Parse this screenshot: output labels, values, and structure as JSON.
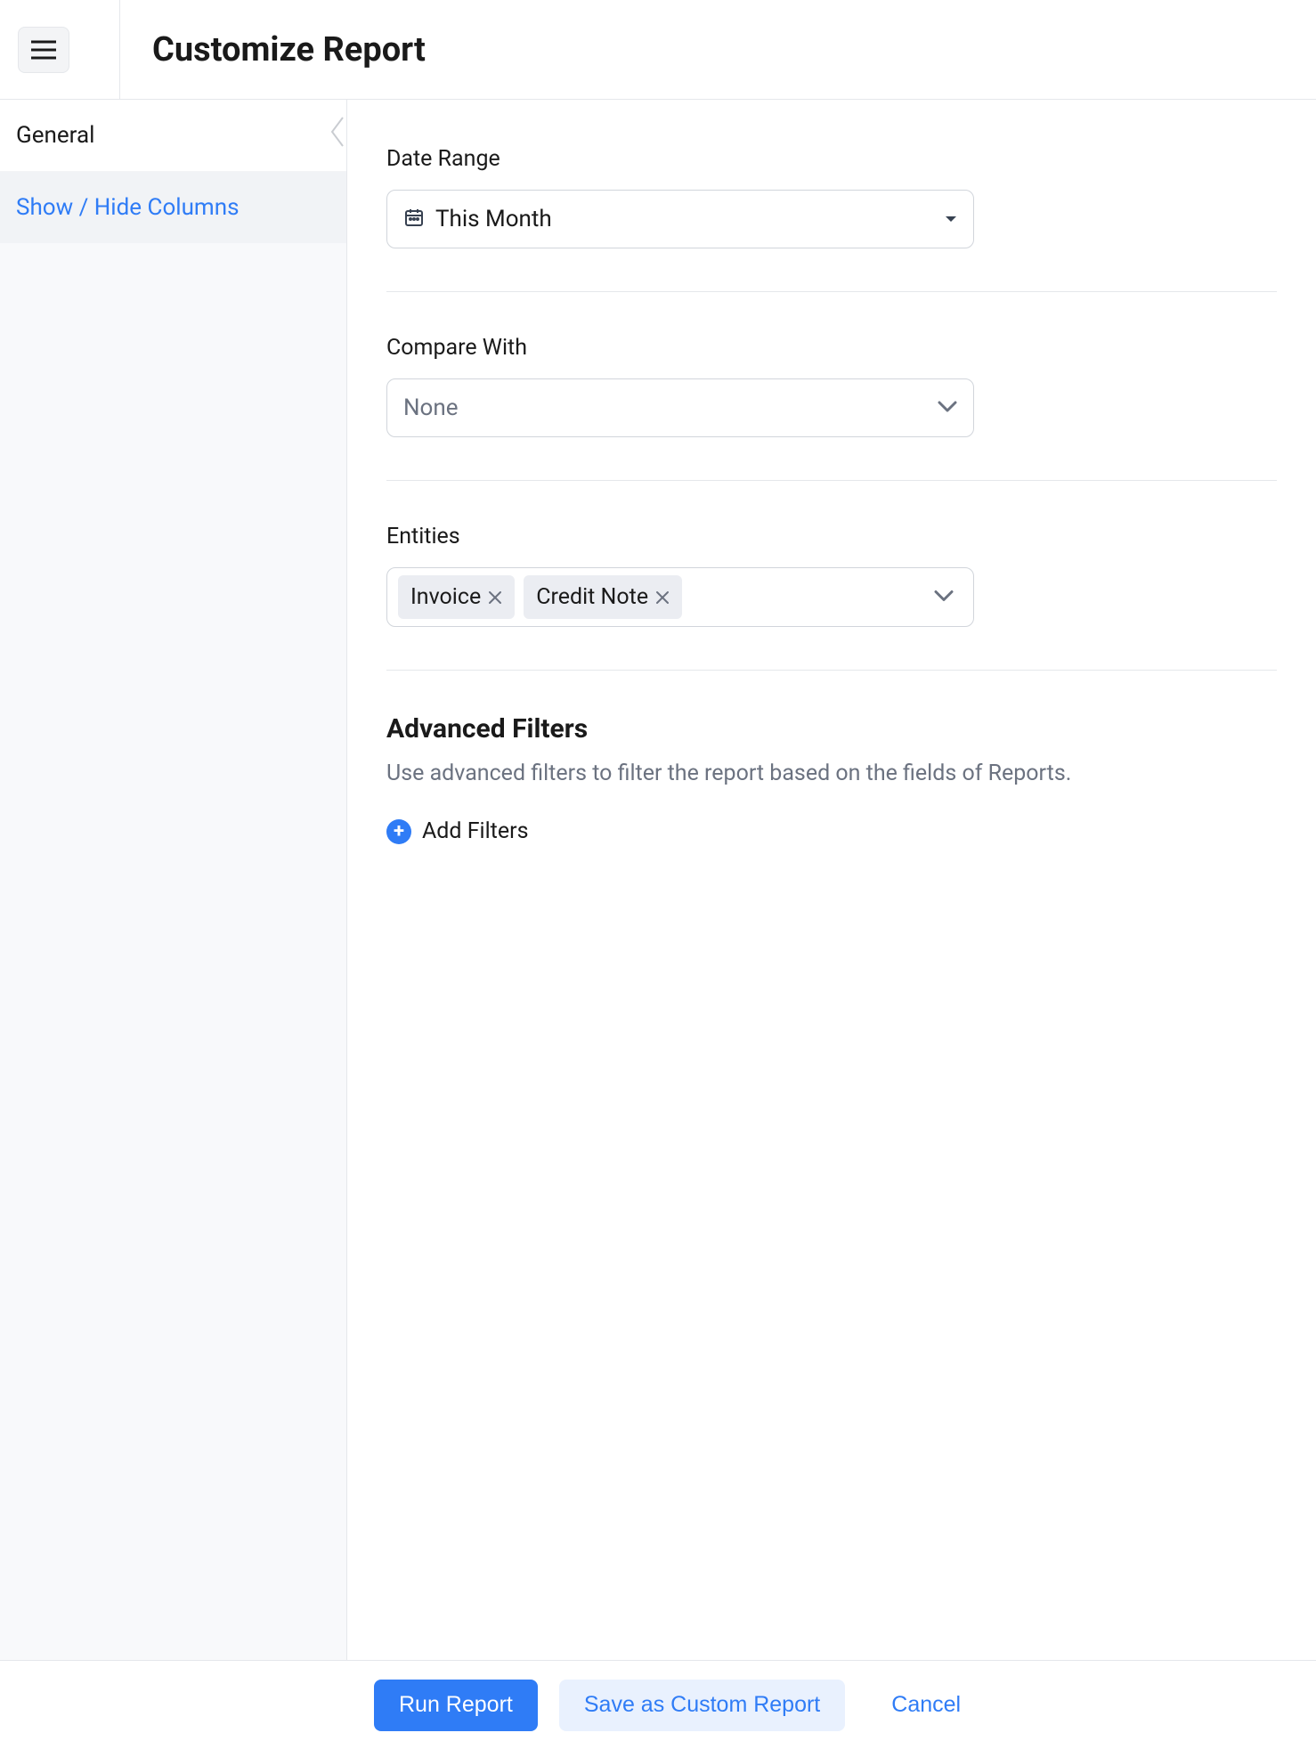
{
  "header": {
    "title": "Customize Report"
  },
  "sidebar": {
    "items": [
      {
        "key": "general",
        "label": "General"
      },
      {
        "key": "columns",
        "label": "Show / Hide Columns"
      }
    ]
  },
  "main": {
    "date_range": {
      "label": "Date Range",
      "value": "This Month"
    },
    "compare_with": {
      "label": "Compare With",
      "value": "None"
    },
    "entities": {
      "label": "Entities",
      "tags": [
        "Invoice",
        "Credit Note"
      ]
    },
    "advanced": {
      "title": "Advanced Filters",
      "description": "Use advanced filters to filter the report based on the fields of Reports.",
      "add_label": "Add Filters"
    }
  },
  "footer": {
    "run": "Run Report",
    "save": "Save as Custom Report",
    "cancel": "Cancel"
  }
}
